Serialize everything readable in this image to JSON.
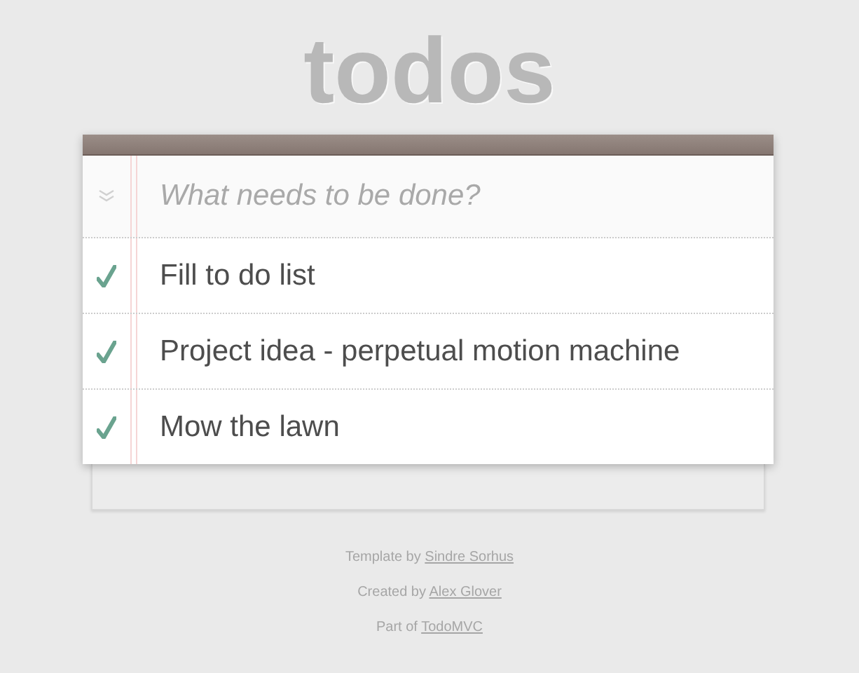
{
  "title": "todos",
  "new_todo": {
    "placeholder": "What needs to be done?"
  },
  "todos": [
    {
      "label": "Fill to do list",
      "completed": true
    },
    {
      "label": "Project idea - perpetual motion machine",
      "completed": true
    },
    {
      "label": "Mow the lawn",
      "completed": true
    }
  ],
  "footer": [
    {
      "text": "Template by",
      "link": "Sindre Sorhus"
    },
    {
      "text": "Created by",
      "link": "Alex Glover"
    },
    {
      "text": "Part of",
      "link": "TodoMVC"
    }
  ]
}
